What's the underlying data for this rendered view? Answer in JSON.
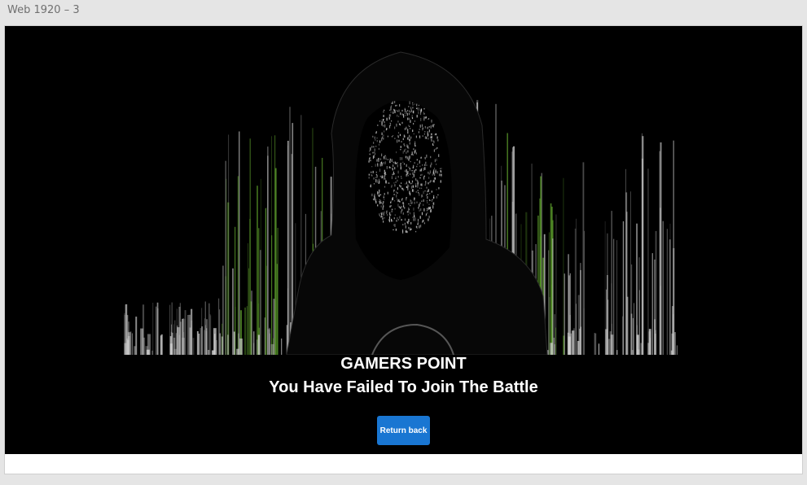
{
  "artboard": {
    "label": "Web 1920 – 3"
  },
  "hero": {
    "brand": "GAMERS POINT",
    "message": "You Have Failed To Join The Battle"
  },
  "actions": {
    "return_label": "Return back"
  },
  "colors": {
    "stage": "#000000",
    "button": "#1976d2",
    "glitch_green": "#5a9a2a",
    "glitch_gray": "#bdbdbd"
  }
}
